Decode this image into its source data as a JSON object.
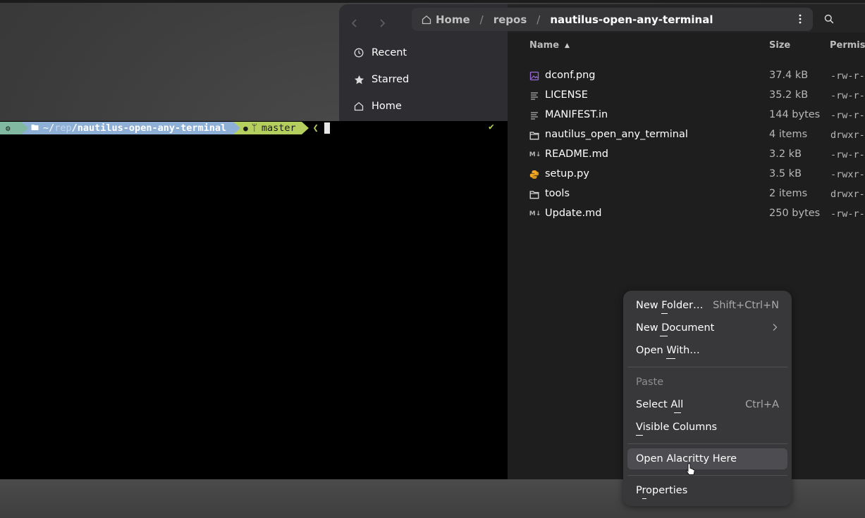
{
  "terminal": {
    "path_home": "~/",
    "path_dim": "rep",
    "path_rest": "/nautilus-open-any-terminal",
    "git_branch": "master",
    "prompt_char": "❮",
    "status": "✔"
  },
  "sidebar": {
    "items": [
      {
        "label": "Recent",
        "icon": "clock-icon"
      },
      {
        "label": "Starred",
        "icon": "star-icon"
      },
      {
        "label": "Home",
        "icon": "home-icon"
      }
    ]
  },
  "pathbar": {
    "crumbs": [
      "Home",
      "repos",
      "nautilus-open-any-terminal"
    ],
    "separator": "/"
  },
  "columns": {
    "name": "Name",
    "size": "Size",
    "permissions": "Permiss"
  },
  "files": [
    {
      "name": "dconf.png",
      "size": "37.4 kB",
      "perm": "-rw-r-",
      "icon": "image-icon"
    },
    {
      "name": "LICENSE",
      "size": "35.2 kB",
      "perm": "-rw-r-",
      "icon": "text-file-icon"
    },
    {
      "name": "MANIFEST.in",
      "size": "144 bytes",
      "perm": "-rw-r-",
      "icon": "text-file-icon"
    },
    {
      "name": "nautilus_open_any_terminal",
      "size": "4 items",
      "perm": "drwxr-",
      "icon": "folder-icon"
    },
    {
      "name": "README.md",
      "size": "3.2 kB",
      "perm": "-rw-r-",
      "icon": "markdown-icon"
    },
    {
      "name": "setup.py",
      "size": "3.5 kB",
      "perm": "-rwxr-",
      "icon": "python-icon"
    },
    {
      "name": "tools",
      "size": "2 items",
      "perm": "drwxr-",
      "icon": "folder-icon"
    },
    {
      "name": "Update.md",
      "size": "250 bytes",
      "perm": "-rw-r-",
      "icon": "markdown-icon"
    }
  ],
  "context_menu": {
    "new_folder": {
      "label": "New Folder…",
      "accel": "Shift+Ctrl+N"
    },
    "new_document": {
      "label": "New Document"
    },
    "open_with": {
      "label": "Open With…"
    },
    "paste": {
      "label": "Paste"
    },
    "select_all": {
      "label": "Select All",
      "accel": "Ctrl+A"
    },
    "visible_columns": {
      "label": "Visible Columns"
    },
    "open_alacritty": {
      "label": "Open Alacritty Here"
    },
    "properties": {
      "label": "Properties"
    }
  },
  "colors": {
    "accent_purple": "#9a6bd8",
    "python_yellow": "#f5a623",
    "terminal_green": "#b5cf5e",
    "terminal_blue": "#8fb0d6",
    "terminal_teal": "#81b8a1"
  }
}
